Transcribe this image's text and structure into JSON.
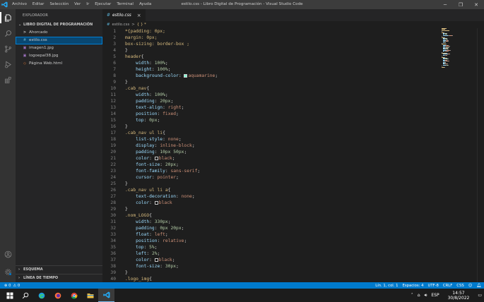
{
  "titlebar": {
    "menu": [
      "Archivo",
      "Editar",
      "Selección",
      "Ver",
      "Ir",
      "Ejecutar",
      "Terminal",
      "Ayuda"
    ],
    "title": "estilo.css - Libro Digital de Programación - Visual Studio Code",
    "controls": {
      "minimize": "─",
      "maximize": "❐",
      "close": "✕"
    }
  },
  "activity_icons": [
    "files-icon",
    "search-icon",
    "source-control-icon",
    "run-debug-icon",
    "extensions-icon",
    "account-icon",
    "settings-gear-icon"
  ],
  "sidebar": {
    "title": "EXPLORADOR",
    "root": "LIBRO DIGITAL DE PROGRAMACIÓN",
    "items": [
      {
        "label": "Ahorcado",
        "icon": ">",
        "type": "folder"
      },
      {
        "label": "estilo.css",
        "icon": "#",
        "type": "css",
        "selected": true
      },
      {
        "label": "imagen1.jpg",
        "icon": "▣",
        "type": "image"
      },
      {
        "label": "logoepal38.jpg",
        "icon": "▣",
        "type": "image"
      },
      {
        "label": "Página Web.html",
        "icon": "◇",
        "type": "html"
      }
    ],
    "sections": [
      "ESQUEMA",
      "LÍNEA DE TIEMPO"
    ]
  },
  "tab": {
    "hash": "#",
    "label": "estilo.css",
    "close": "×"
  },
  "breadcrumb": {
    "hash": "#",
    "file": "estilo.css",
    "sep": ">",
    "symbol": "{ } *"
  },
  "code_lines": [
    [
      [
        "sel",
        "*{padding: 0px;"
      ]
    ],
    [
      [
        "sel",
        "margin: 0px;"
      ]
    ],
    [
      [
        "sel",
        "box-sizing: border-box ;"
      ]
    ],
    [
      [
        "pun",
        "}"
      ]
    ],
    [
      [
        "sel",
        "header"
      ],
      [
        "pun",
        "{"
      ]
    ],
    [
      [
        "pun",
        "    "
      ],
      [
        "prop",
        "width"
      ],
      [
        "pun",
        ": "
      ],
      [
        "num",
        "100%"
      ],
      [
        "pun",
        ";"
      ]
    ],
    [
      [
        "pun",
        "    "
      ],
      [
        "prop",
        "height"
      ],
      [
        "pun",
        ": "
      ],
      [
        "num",
        "100%"
      ],
      [
        "pun",
        ";"
      ]
    ],
    [
      [
        "pun",
        "    "
      ],
      [
        "prop",
        "background-color"
      ],
      [
        "pun",
        ": "
      ],
      [
        "swatch",
        "#7fffd4"
      ],
      [
        "val",
        "aquamarine"
      ],
      [
        "pun",
        ";"
      ]
    ],
    [
      [
        "pun",
        "}"
      ]
    ],
    [
      [
        "sel",
        ".cab_nav"
      ],
      [
        "pun",
        "{"
      ]
    ],
    [
      [
        "pun",
        "    "
      ],
      [
        "prop",
        "width"
      ],
      [
        "pun",
        ": "
      ],
      [
        "num",
        "100%"
      ],
      [
        "pun",
        ";"
      ]
    ],
    [
      [
        "pun",
        "    "
      ],
      [
        "prop",
        "padding"
      ],
      [
        "pun",
        ": "
      ],
      [
        "num",
        "20px"
      ],
      [
        "pun",
        ";"
      ]
    ],
    [
      [
        "pun",
        "    "
      ],
      [
        "prop",
        "text-align"
      ],
      [
        "pun",
        ": "
      ],
      [
        "val",
        "right"
      ],
      [
        "pun",
        ";"
      ]
    ],
    [
      [
        "pun",
        "    "
      ],
      [
        "prop",
        "position"
      ],
      [
        "pun",
        ": "
      ],
      [
        "val",
        "fixed"
      ],
      [
        "pun",
        ";"
      ]
    ],
    [
      [
        "pun",
        "    "
      ],
      [
        "prop",
        "top"
      ],
      [
        "pun",
        ": "
      ],
      [
        "num",
        "0px"
      ],
      [
        "pun",
        ";"
      ]
    ],
    [
      [
        "pun",
        "}"
      ]
    ],
    [
      [
        "sel",
        ".cab_nav ul li"
      ],
      [
        "pun",
        "{"
      ]
    ],
    [
      [
        "pun",
        "    "
      ],
      [
        "prop",
        "list-style"
      ],
      [
        "pun",
        ": "
      ],
      [
        "val",
        "none"
      ],
      [
        "pun",
        ";"
      ]
    ],
    [
      [
        "pun",
        "    "
      ],
      [
        "prop",
        "display"
      ],
      [
        "pun",
        ": "
      ],
      [
        "val",
        "inline-block"
      ],
      [
        "pun",
        ";"
      ]
    ],
    [
      [
        "pun",
        "    "
      ],
      [
        "prop",
        "padding"
      ],
      [
        "pun",
        ": "
      ],
      [
        "num",
        "10px 50px"
      ],
      [
        "pun",
        ";"
      ]
    ],
    [
      [
        "pun",
        "    "
      ],
      [
        "prop",
        "color"
      ],
      [
        "pun",
        ": "
      ],
      [
        "swatch",
        "#000000"
      ],
      [
        "val",
        "black"
      ],
      [
        "pun",
        ";"
      ]
    ],
    [
      [
        "pun",
        "    "
      ],
      [
        "prop",
        "font-size"
      ],
      [
        "pun",
        ": "
      ],
      [
        "num",
        "20px"
      ],
      [
        "pun",
        ";"
      ]
    ],
    [
      [
        "pun",
        "    "
      ],
      [
        "prop",
        "font-family"
      ],
      [
        "pun",
        ": "
      ],
      [
        "val",
        "sans-serif"
      ],
      [
        "pun",
        ";"
      ]
    ],
    [
      [
        "pun",
        "    "
      ],
      [
        "prop",
        "cursor"
      ],
      [
        "pun",
        ": "
      ],
      [
        "val",
        "pointer"
      ],
      [
        "pun",
        ";"
      ]
    ],
    [
      [
        "pun",
        "}"
      ]
    ],
    [
      [
        "sel",
        ".cab_nav ul li a"
      ],
      [
        "pun",
        "{"
      ]
    ],
    [
      [
        "pun",
        "    "
      ],
      [
        "prop",
        "text-decoration"
      ],
      [
        "pun",
        ": "
      ],
      [
        "val",
        "none"
      ],
      [
        "pun",
        ";"
      ]
    ],
    [
      [
        "pun",
        "    "
      ],
      [
        "prop",
        "color"
      ],
      [
        "pun",
        ": "
      ],
      [
        "swatch",
        "#000000"
      ],
      [
        "val",
        "black"
      ]
    ],
    [
      [
        "pun",
        "}"
      ]
    ],
    [
      [
        "sel",
        ".nom_LOGO"
      ],
      [
        "pun",
        "{"
      ]
    ],
    [
      [
        "pun",
        "    "
      ],
      [
        "prop",
        "width"
      ],
      [
        "pun",
        ": "
      ],
      [
        "num",
        "330px"
      ],
      [
        "pun",
        ";"
      ]
    ],
    [
      [
        "pun",
        "    "
      ],
      [
        "prop",
        "padding"
      ],
      [
        "pun",
        ": "
      ],
      [
        "num",
        "0px 20px"
      ],
      [
        "pun",
        ";"
      ]
    ],
    [
      [
        "pun",
        "    "
      ],
      [
        "prop",
        "float"
      ],
      [
        "pun",
        ": "
      ],
      [
        "val",
        "left"
      ],
      [
        "pun",
        ";"
      ]
    ],
    [
      [
        "pun",
        "    "
      ],
      [
        "prop",
        "position"
      ],
      [
        "pun",
        ": "
      ],
      [
        "val",
        "relative"
      ],
      [
        "pun",
        ";"
      ]
    ],
    [
      [
        "pun",
        "    "
      ],
      [
        "prop",
        "top"
      ],
      [
        "pun",
        ": "
      ],
      [
        "num",
        "5%"
      ],
      [
        "pun",
        ";"
      ]
    ],
    [
      [
        "pun",
        "    "
      ],
      [
        "prop",
        "left"
      ],
      [
        "pun",
        ": "
      ],
      [
        "num",
        "2%"
      ],
      [
        "pun",
        ";"
      ]
    ],
    [
      [
        "pun",
        "    "
      ],
      [
        "prop",
        "color"
      ],
      [
        "pun",
        ": "
      ],
      [
        "swatch",
        "#000000"
      ],
      [
        "val",
        "black"
      ],
      [
        "pun",
        ";"
      ]
    ],
    [
      [
        "pun",
        "    "
      ],
      [
        "prop",
        "font-size"
      ],
      [
        "pun",
        ": "
      ],
      [
        "num",
        "30px"
      ],
      [
        "pun",
        ";"
      ]
    ],
    [
      [
        "pun",
        "}"
      ]
    ],
    [
      [
        "sel",
        ".logo_img"
      ],
      [
        "pun",
        "{"
      ]
    ]
  ],
  "status": {
    "errors": "⊗ 0",
    "warnings": "⚠ 0",
    "position": "Lín. 1, col. 1",
    "spaces": "Espacios: 4",
    "encoding": "UTF-8",
    "eol": "CRLF",
    "language": "CSS"
  },
  "taskbar": {
    "time": "14:57",
    "date": "30/8/2022",
    "lang": "ESP"
  },
  "colors": {
    "accent": "#007acc",
    "selector": "#d7ba7d",
    "property": "#9cdcfe",
    "value": "#ce9178",
    "number": "#b5cea8"
  }
}
